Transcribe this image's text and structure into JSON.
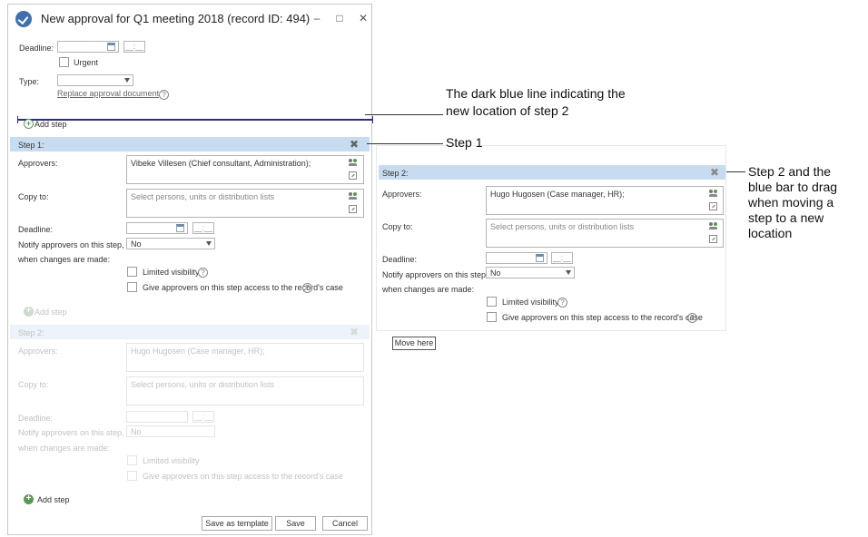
{
  "window": {
    "title": "New approval for Q1 meeting 2018 (record ID: 494)",
    "minimize": "–",
    "maximize": "□",
    "close": "✕"
  },
  "form": {
    "deadline_label": "Deadline:",
    "time_placeholder": "__:__",
    "urgent_label": "Urgent",
    "type_label": "Type:",
    "replace_link": "Replace approval document",
    "help_glyph": "?"
  },
  "add_step_label": "Add step",
  "plus_glyph": "+",
  "close_glyph": "✖",
  "step1": {
    "title": "Step 1:",
    "approvers_label": "Approvers:",
    "approvers_value": "Vibeke Villesen (Chief consultant, Administration);",
    "copy_label": "Copy to:",
    "copy_placeholder": "Select persons, units or distribution lists",
    "deadline_label": "Deadline:",
    "notify_label_1": "Notify approvers on this step,",
    "notify_label_2": "when changes are made:",
    "notify_value": "No",
    "limited_label": "Limited visibility",
    "access_label": "Give approvers on this step access to the record's case"
  },
  "step2": {
    "title": "Step 2:",
    "approvers_label": "Approvers:",
    "approvers_value": "Hugo Hugosen (Case manager, HR);",
    "copy_label": "Copy to:",
    "copy_placeholder": "Select persons, units or distribution lists",
    "deadline_label": "Deadline:",
    "notify_label_1": "Notify approvers on this step,",
    "notify_label_2": "when changes are made:",
    "notify_value": "No",
    "limited_label": "Limited visibility",
    "access_label": "Give approvers on this step access to the record's case"
  },
  "footer": {
    "save_template": "Save as template",
    "save": "Save",
    "cancel": "Cancel"
  },
  "move_here": "Move here",
  "annotations": {
    "drop_line_1": "The dark blue line indicating the",
    "drop_line_2": "new location of step 2",
    "step1": "Step 1",
    "step2_1": "Step 2 and the",
    "step2_2": "blue bar to drag",
    "step2_3": "when moving a",
    "step2_4": "step to a new",
    "step2_5": "location"
  },
  "colors": {
    "step_bar": "#c7dcf0",
    "drop_line": "#2b2b8a",
    "add_icon": "#5a9a52"
  }
}
